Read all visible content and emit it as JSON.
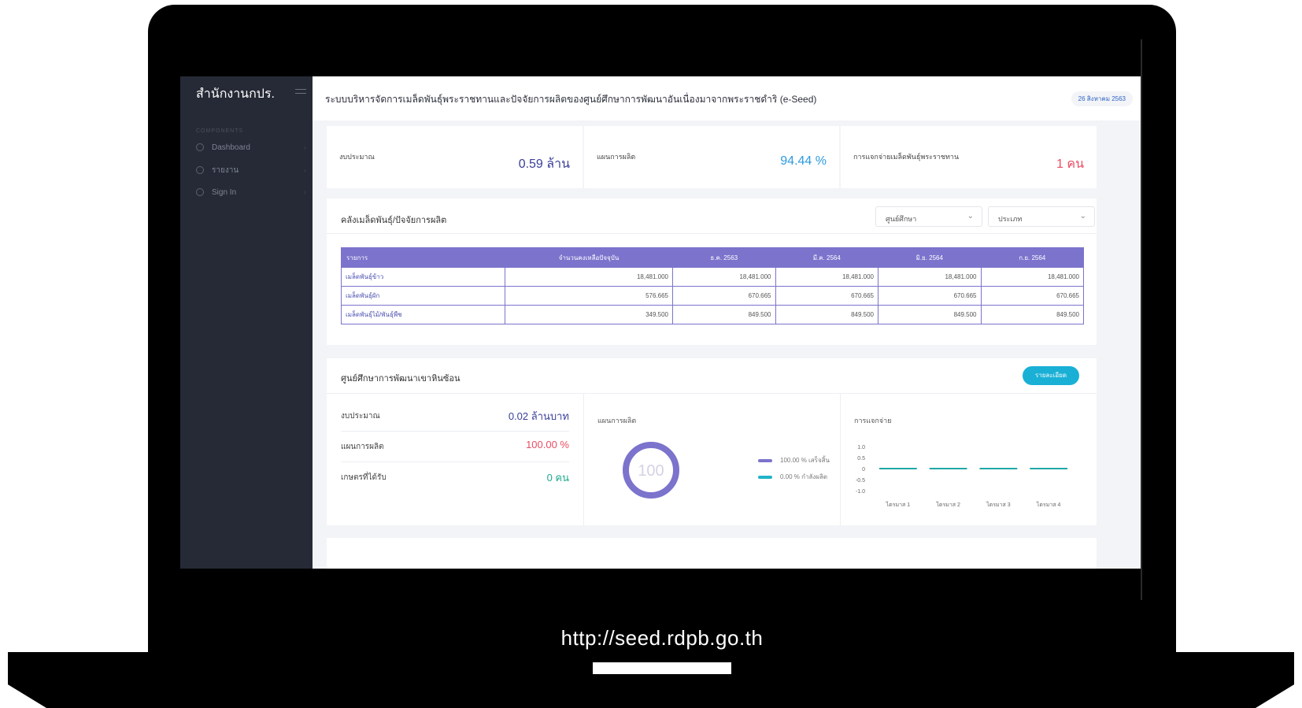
{
  "footer_url": "http://seed.rdpb.go.th",
  "sidebar": {
    "brand": "สำนักงานกปร.",
    "section_label": "COMPONENTS",
    "items": [
      {
        "label": "Dashboard"
      },
      {
        "label": "รายงาน"
      },
      {
        "label": "Sign In"
      }
    ]
  },
  "header": {
    "title": "ระบบบริหารจัดการเมล็ดพันธุ์พระราชทานและปัจจัยการผลิตของศูนย์ศึกษาการพัฒนาอันเนื่องมาจากพระราชดำริ (e-Seed)",
    "date": "26 สิงหาคม 2563"
  },
  "summary": [
    {
      "label": "งบประมาณ",
      "value": "0.59 ล้าน",
      "color": "#3a3f99"
    },
    {
      "label": "แผนการผลิต",
      "value": "94.44 %",
      "color": "#2d9be0"
    },
    {
      "label": "การแจกจ่ายเมล็ดพันธุ์พระราชทาน",
      "value": "1 คน",
      "color": "#ea4c63"
    }
  ],
  "inventory": {
    "title": "คลังเมล็ดพันธุ์/ปัจจัยการผลิต",
    "filter_center": "ศูนย์ศึกษา",
    "filter_type": "ประเภท",
    "columns": [
      "รายการ",
      "จำนวนคงเหลือปัจจุบัน",
      "ธ.ค. 2563",
      "มี.ค. 2564",
      "มิ.ย. 2564",
      "ก.ย. 2564"
    ],
    "rows": [
      [
        "เมล็ดพันธุ์ข้าว",
        "18,481.000",
        "18,481.000",
        "18,481.000",
        "18,481.000",
        "18,481.000"
      ],
      [
        "เมล็ดพันธุ์ผัก",
        "576.665",
        "670.665",
        "670.665",
        "670.665",
        "670.665"
      ],
      [
        "เมล็ดพันธุ์ไม้/พันธุ์พืช",
        "349.500",
        "849.500",
        "849.500",
        "849.500",
        "849.500"
      ]
    ]
  },
  "center": {
    "title": "ศูนย์ศึกษาการพัฒนาเขาหินซ้อน",
    "detail_button": "รายละเอียด",
    "stats": [
      {
        "label": "งบประมาณ",
        "value": "0.02 ล้านบาท",
        "color": "#3a3f99"
      },
      {
        "label": "แผนการผลิต",
        "value": "100.00 %",
        "color": "#ea4c63"
      },
      {
        "label": "เกษตรที่ได้รับ",
        "value": "0 คน",
        "color": "#1faa8c"
      }
    ],
    "production_title": "แผนการผลิต",
    "donut_label": "100",
    "legend": [
      {
        "label": "100.00 % เสร็จสิ้น",
        "color": "#7b73cc"
      },
      {
        "label": "0.00 % กำลังผลิต",
        "color": "#22b3c8"
      }
    ],
    "distribution_title": "การแจกจ่าย"
  },
  "chart_data": {
    "type": "line",
    "title": "การแจกจ่าย",
    "categories": [
      "ไตรมาส 1",
      "ไตรมาส 2",
      "ไตรมาส 3",
      "ไตรมาส 4"
    ],
    "values": [
      0,
      0,
      0,
      0
    ],
    "yticks": [
      "1.0",
      "0.5",
      "0",
      "-0.5",
      "-1.0"
    ],
    "ylim": [
      -1.0,
      1.0
    ],
    "color": "#1fa7a7"
  }
}
